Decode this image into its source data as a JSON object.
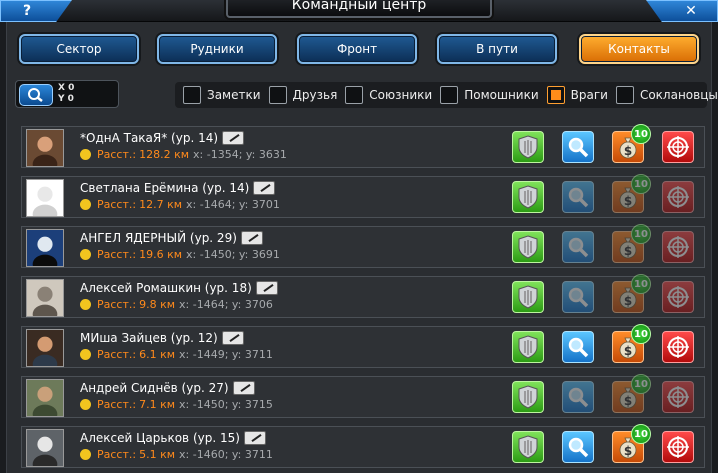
{
  "window": {
    "title": "Командный центр",
    "help_label": "?",
    "close_label": "✕"
  },
  "tabs": [
    {
      "label": "Сектор",
      "active": false
    },
    {
      "label": "Рудники",
      "active": false
    },
    {
      "label": "Фронт",
      "active": false
    },
    {
      "label": "В пути",
      "active": false
    },
    {
      "label": "Контакты",
      "active": true
    }
  ],
  "coords": {
    "x_label": "X 0",
    "y_label": "Y 0"
  },
  "filters": [
    {
      "label": "Заметки",
      "checked": false
    },
    {
      "label": "Друзья",
      "checked": false
    },
    {
      "label": "Союзники",
      "checked": false
    },
    {
      "label": "Помошники",
      "checked": false
    },
    {
      "label": "Враги",
      "checked": true
    },
    {
      "label": "Соклановцы",
      "checked": false
    }
  ],
  "contacts": [
    {
      "name": "*ОднА ТакаЯ*  (ур. 14)",
      "dist_label": "Расст.:",
      "distance": "128.2 км",
      "coords": "x: -1354; y: 3631",
      "badge": "10",
      "spy_active": true,
      "trade_active": true,
      "attack_active": true
    },
    {
      "name": "Светлана Ерёмина  (ур. 14)",
      "dist_label": "Расст.:",
      "distance": "12.7 км",
      "coords": "x: -1464; y: 3701",
      "badge": "10",
      "spy_active": false,
      "trade_active": false,
      "attack_active": false
    },
    {
      "name": "АНГЕЛ ЯДЕРНЫЙ  (ур. 29)",
      "dist_label": "Расст.:",
      "distance": "19.6 км",
      "coords": "x: -1450; y: 3691",
      "badge": "10",
      "spy_active": false,
      "trade_active": false,
      "attack_active": false
    },
    {
      "name": "Алексей Ромашкин  (ур. 18)",
      "dist_label": "Расст.:",
      "distance": "9.8 км",
      "coords": "x: -1464; y: 3706",
      "badge": "10",
      "spy_active": false,
      "trade_active": false,
      "attack_active": false
    },
    {
      "name": "МИша Зайцев  (ур. 12)",
      "dist_label": "Расст.:",
      "distance": "6.1 км",
      "coords": "x: -1449; y: 3711",
      "badge": "10",
      "spy_active": true,
      "trade_active": true,
      "attack_active": true
    },
    {
      "name": "Андрей Сиднёв  (ур. 27)",
      "dist_label": "Расст.:",
      "distance": "7.1 км",
      "coords": "x: -1450; y: 3715",
      "badge": "10",
      "spy_active": false,
      "trade_active": false,
      "attack_active": false
    },
    {
      "name": "Алексей Царьков  (ур. 15)",
      "dist_label": "Расст.:",
      "distance": "5.1 км",
      "coords": "x: -1460; y: 3711",
      "badge": "10",
      "spy_active": true,
      "trade_active": true,
      "attack_active": true
    }
  ]
}
